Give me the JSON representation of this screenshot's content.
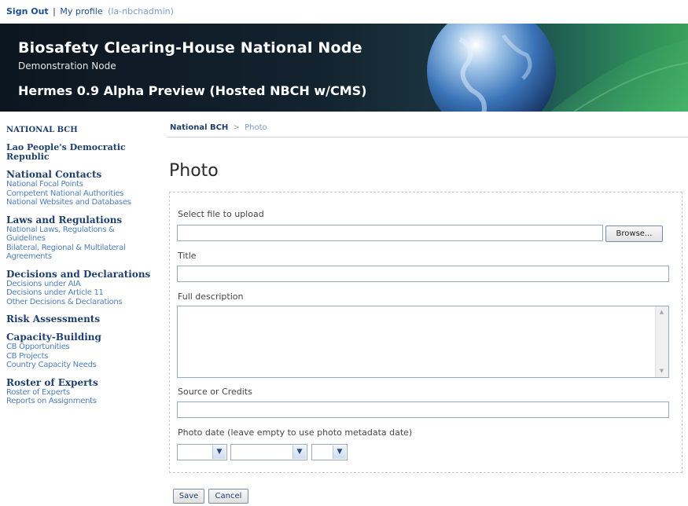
{
  "topbar": {
    "sign_out": "Sign Out",
    "separator": "|",
    "my_profile": "My profile",
    "user": "(la-nbchadmin)"
  },
  "banner": {
    "title": "Biosafety Clearing-House National Node",
    "subtitle": "Demonstration Node",
    "preview": "Hermes 0.9 Alpha Preview (Hosted NBCH w/CMS)"
  },
  "sidebar": {
    "header": "NATIONAL BCH",
    "country": "Lao People's Democratic Republic",
    "sections": [
      {
        "title": "National Contacts",
        "links": [
          "National Focal Points",
          "Competent National Authorities",
          "National Websites and Databases"
        ]
      },
      {
        "title": "Laws and Regulations",
        "links": [
          "National Laws, Regulations & Guidelines",
          "Bilateral, Regional & Multilateral Agreements"
        ]
      },
      {
        "title": "Decisions and Declarations",
        "links": [
          "Decisions under AIA",
          "Decisions under Article 11",
          "Other Decisions & Declarations"
        ]
      },
      {
        "title": "Risk Assessments",
        "links": []
      },
      {
        "title": "Capacity-Building",
        "links": [
          "CB Opportunities",
          "CB Projects",
          "Country Capacity Needs"
        ]
      },
      {
        "title": "Roster of Experts",
        "links": [
          "Roster of Experts",
          "Reports on Assignments"
        ]
      }
    ]
  },
  "breadcrumb": {
    "root": "National BCH",
    "arrow": ">",
    "current": "Photo"
  },
  "page_title": "Photo",
  "form": {
    "file_label": "Select file to upload",
    "file_value": "",
    "browse_label": "Browse...",
    "title_label": "Title",
    "title_value": "",
    "description_label": "Full description",
    "description_value": "",
    "source_label": "Source or Credits",
    "source_value": "",
    "date_label": "Photo date (leave empty to use photo metadata date)",
    "date_day": "",
    "date_month": "",
    "date_year": ""
  },
  "buttons": {
    "save": "Save",
    "cancel": "Cancel"
  },
  "icons": {
    "dropdown": "chevron-down-icon",
    "scroll_up": "scroll-up-icon",
    "scroll_down": "scroll-down-icon"
  },
  "colors": {
    "link": "#4f7fb8",
    "heading": "#1e3f6e",
    "banner_dark": "#0c1620",
    "banner_green": "#3aa05a"
  }
}
